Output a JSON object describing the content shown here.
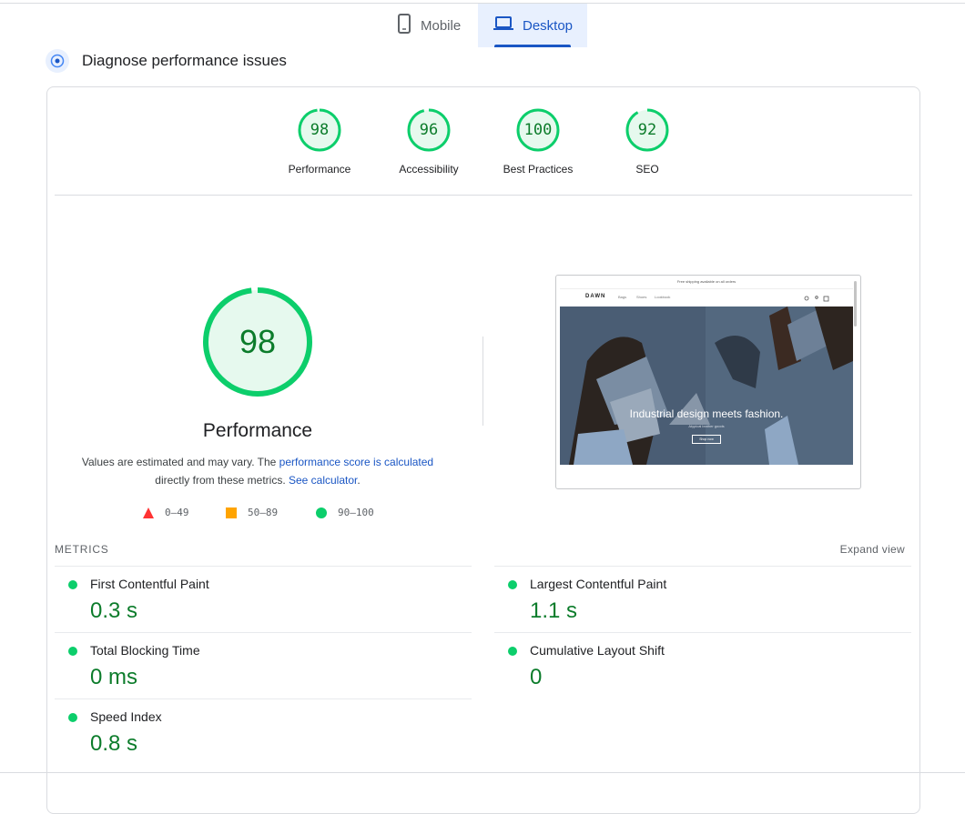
{
  "tabs": [
    {
      "label": "Mobile",
      "icon": "phone-icon",
      "selected": false
    },
    {
      "label": "Desktop",
      "icon": "laptop-icon",
      "selected": true
    }
  ],
  "section": {
    "title": "Diagnose performance issues"
  },
  "colors": {
    "pass": "#0cce6b",
    "pass_text": "#0c7c2b",
    "average": "#ffa400",
    "fail": "#ff3333",
    "accent": "#1a56c4"
  },
  "gauges": [
    {
      "label": "Performance",
      "score": "98"
    },
    {
      "label": "Accessibility",
      "score": "96"
    },
    {
      "label": "Best Practices",
      "score": "100"
    },
    {
      "label": "SEO",
      "score": "92"
    }
  ],
  "performance": {
    "score": "98",
    "title": "Performance",
    "desc_prefix": "Values are estimated and may vary. The ",
    "desc_link1": "performance score is calculated",
    "desc_middle": " directly from these metrics. ",
    "desc_link2": "See calculator",
    "desc_suffix": "."
  },
  "legend": [
    {
      "shape": "triangle",
      "range": "0–49"
    },
    {
      "shape": "square",
      "range": "50–89"
    },
    {
      "shape": "circle",
      "range": "90–100"
    }
  ],
  "screenshot": {
    "announcement": "Free shipping available on all orders",
    "logo": "DAWN",
    "menu": [
      "Bags",
      "Shoes",
      "Lookbook"
    ],
    "headline": "Industrial design meets fashion.",
    "subtext": "Atypical leather goods",
    "button": "Shop now"
  },
  "metrics": {
    "header": "METRICS",
    "expand_label": "Expand view",
    "items": [
      {
        "name": "First Contentful Paint",
        "value": "0.3 s"
      },
      {
        "name": "Largest Contentful Paint",
        "value": "1.1 s"
      },
      {
        "name": "Total Blocking Time",
        "value": "0 ms"
      },
      {
        "name": "Cumulative Layout Shift",
        "value": "0"
      },
      {
        "name": "Speed Index",
        "value": "0.8 s"
      }
    ]
  }
}
